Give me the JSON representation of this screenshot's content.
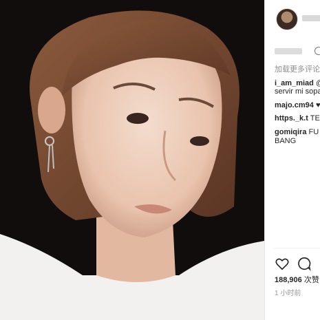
{
  "post": {
    "image_alt": "selfie photo",
    "load_more": "加载更多评论",
    "comments": [
      {
        "user": "i_am_miad",
        "text": "@"
      },
      {
        "user": "",
        "text": "servir mi sopa"
      },
      {
        "user": "majo.cm94",
        "text": "♥"
      },
      {
        "user": "https._k.t",
        "text": "TE"
      },
      {
        "user": "gomiqira",
        "text": "FU"
      },
      {
        "user": "",
        "text": "BANG"
      }
    ],
    "likes_count": "188,906",
    "likes_label": "次赞",
    "time_ago": "1 小时前"
  },
  "icons": [
    "heart-icon",
    "comment-icon",
    "verified-icon",
    "avatar"
  ]
}
